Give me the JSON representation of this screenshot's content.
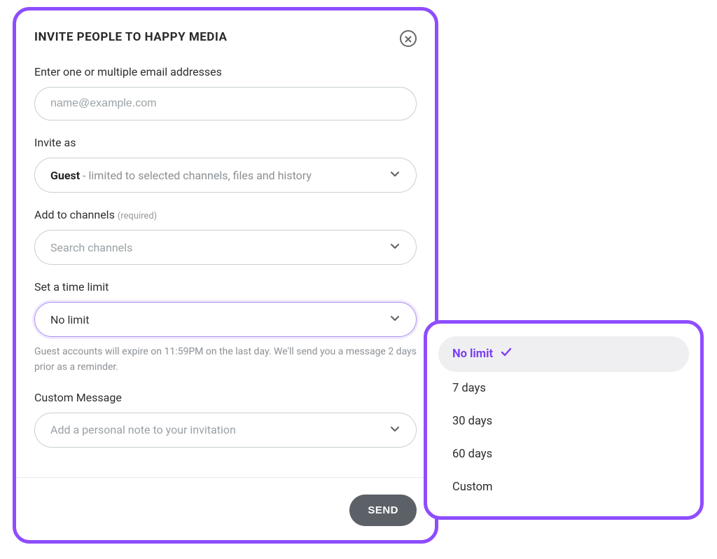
{
  "modal": {
    "title": "INVITE PEOPLE TO HAPPY MEDIA",
    "email": {
      "label": "Enter one or multiple email addresses",
      "placeholder": "name@example.com",
      "value": ""
    },
    "invite_as": {
      "label": "Invite as",
      "selected_bold": "Guest",
      "selected_rest": " - limited to selected channels, files and history"
    },
    "channels": {
      "label": "Add to channels ",
      "required": "(required)",
      "placeholder": "Search channels"
    },
    "time_limit": {
      "label": "Set a time limit",
      "selected": "No limit",
      "helper": "Guest accounts will expire on 11:59PM on the last day. We'll send you a message 2 days prior as a reminder."
    },
    "custom_message": {
      "label": "Custom Message",
      "placeholder": "Add a personal note to your invitation"
    },
    "send_label": "SEND"
  },
  "dropdown": {
    "options": [
      {
        "label": "No limit",
        "selected": true
      },
      {
        "label": "7 days",
        "selected": false
      },
      {
        "label": "30 days",
        "selected": false
      },
      {
        "label": "60 days",
        "selected": false
      },
      {
        "label": "Custom",
        "selected": false
      }
    ]
  }
}
